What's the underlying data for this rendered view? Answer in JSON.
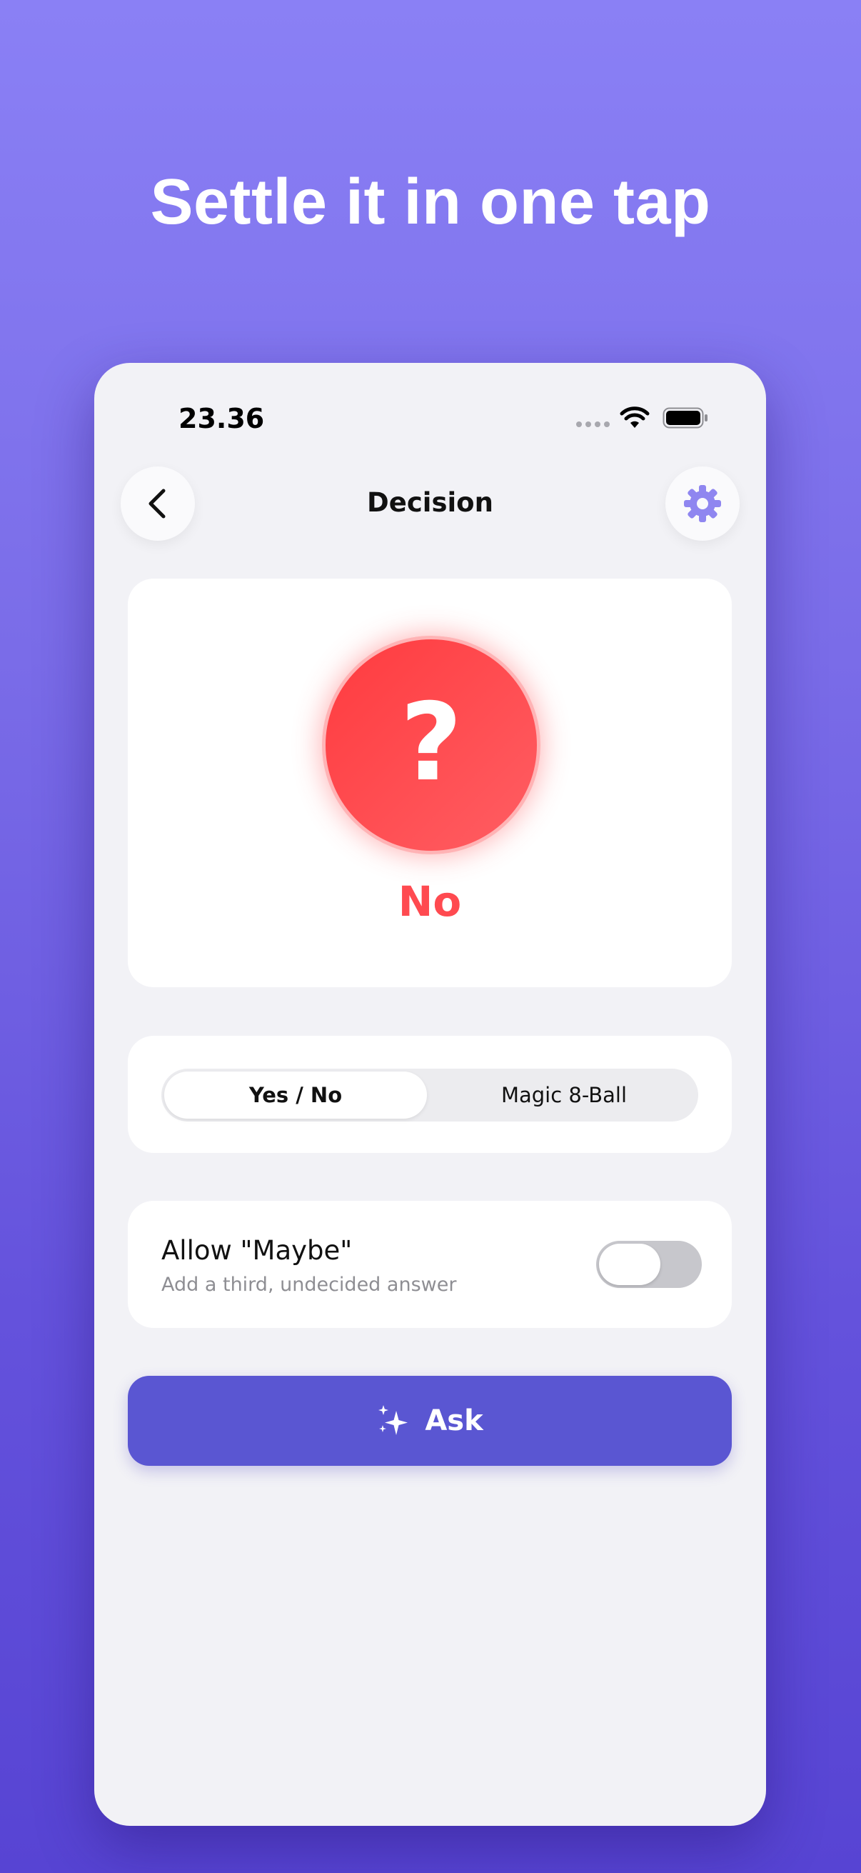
{
  "headline": "Settle it in one tap",
  "status_bar": {
    "time": "23.36",
    "icons": [
      "signal-dots-icon",
      "wifi-icon",
      "battery-icon"
    ]
  },
  "nav": {
    "title": "Decision",
    "back_icon": "chevron-left-icon",
    "settings_icon": "gear-icon"
  },
  "result": {
    "symbol": "?",
    "answer": "No"
  },
  "mode": {
    "options": [
      "Yes / No",
      "Magic 8-Ball"
    ],
    "selected": "Yes / No"
  },
  "maybe": {
    "label": "Allow \"Maybe\"",
    "description": "Add a third, undecided answer",
    "enabled": false
  },
  "ask_button": {
    "label": "Ask",
    "icon": "sparkles-icon"
  },
  "colors": {
    "background_top": "#8a80f5",
    "background_bottom": "#5744d3",
    "answer_red": "#ff4a50",
    "button_accent": "#5a56d2",
    "gear_accent": "#8f86f0"
  }
}
